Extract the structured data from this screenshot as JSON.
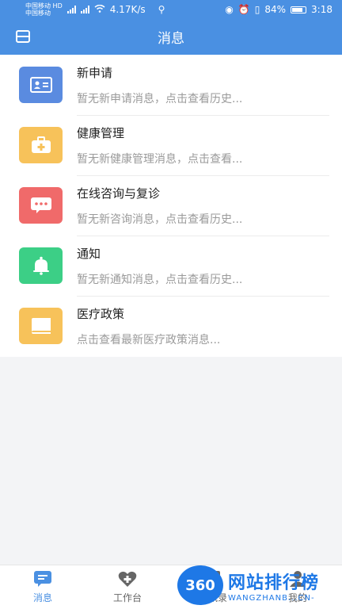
{
  "status_bar": {
    "carrier1": "中国移动",
    "hd": "HD",
    "carrier2": "中国移动",
    "net_speed": "4.17K/s",
    "battery": "84%",
    "time": "3:18"
  },
  "header": {
    "title": "消息"
  },
  "messages": [
    {
      "title": "新申请",
      "desc": "暂无新申请消息，点击查看历史...",
      "icon": "id-card-icon",
      "color": "#5a8be0"
    },
    {
      "title": "健康管理",
      "desc": "暂无新健康管理消息，点击查看...",
      "icon": "medical-kit-icon",
      "color": "#f7c25a"
    },
    {
      "title": "在线咨询与复诊",
      "desc": "暂无新咨询消息，点击查看历史...",
      "icon": "chat-bubble-icon",
      "color": "#f06a6a"
    },
    {
      "title": "通知",
      "desc": "暂无新通知消息，点击查看历史...",
      "icon": "bell-icon",
      "color": "#3ccf86"
    },
    {
      "title": "医疗政策",
      "desc": "点击查看最新医疗政策消息...",
      "icon": "book-icon",
      "color": "#f7c25a"
    }
  ],
  "tabbar": {
    "tabs": [
      {
        "label": "消息",
        "icon": "message-icon"
      },
      {
        "label": "工作台",
        "icon": "workbench-icon"
      },
      {
        "label": "通讯录",
        "icon": "contacts-icon"
      },
      {
        "label": "我的",
        "icon": "profile-icon"
      }
    ]
  },
  "watermark": {
    "logo": "360",
    "name": "网站排行榜",
    "domain": "WANGZHANB...CN-"
  },
  "colors": {
    "primary": "#4a90e2"
  }
}
